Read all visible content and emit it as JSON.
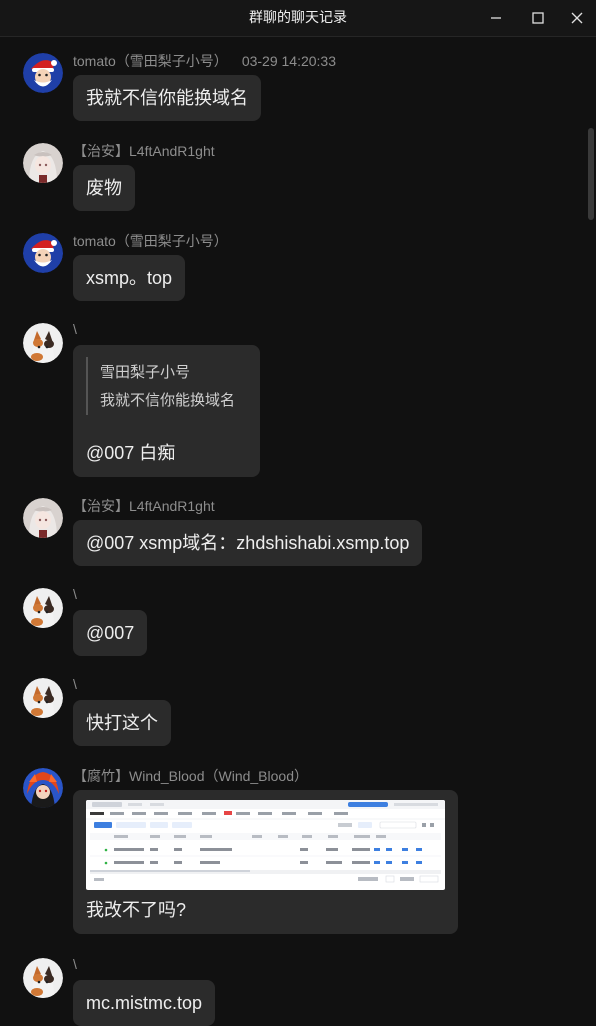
{
  "window": {
    "title": "群聊的聊天记录",
    "minimize_icon": "minimize-icon",
    "maximize_icon": "maximize-icon",
    "close_icon": "close-icon"
  },
  "messages": [
    {
      "sender": "tomato（雪田梨子小号）",
      "time": "03-29 14:20:33",
      "text": "我就不信你能换域名",
      "avatar": "santa-avatar"
    },
    {
      "sender": "【治安】L4ftAndR1ght",
      "text": "废物",
      "avatar": "anime-girl-avatar"
    },
    {
      "sender": "tomato（雪田梨子小号）",
      "text": "xsmp。top",
      "avatar": "santa-avatar"
    },
    {
      "sender": "\\",
      "quote_name": "雪田梨子小号",
      "quote_text": "我就不信你能换域名",
      "text": "@007 白痴",
      "avatar": "calico-cat-avatar"
    },
    {
      "sender": "【治安】L4ftAndR1ght",
      "text": "@007 xsmp域名：zhdshishabi.xsmp.top",
      "avatar": "anime-girl-avatar"
    },
    {
      "sender": "\\",
      "text": "@007",
      "avatar": "calico-cat-avatar"
    },
    {
      "sender": "\\",
      "text": "快打这个",
      "avatar": "calico-cat-avatar"
    },
    {
      "sender": "【腐竹】Wind_Blood（Wind_Blood）",
      "image": "dns-records-screenshot",
      "text": "我改不了吗?",
      "avatar": "red-hair-avatar"
    },
    {
      "sender": "\\",
      "text": "mc.mistmc.top",
      "avatar": "calico-cat-avatar"
    }
  ],
  "colors": {
    "background": "#111111",
    "bubble": "#2b2b2b",
    "sender_text": "#8d8d8d",
    "message_text": "#eeeeee"
  }
}
